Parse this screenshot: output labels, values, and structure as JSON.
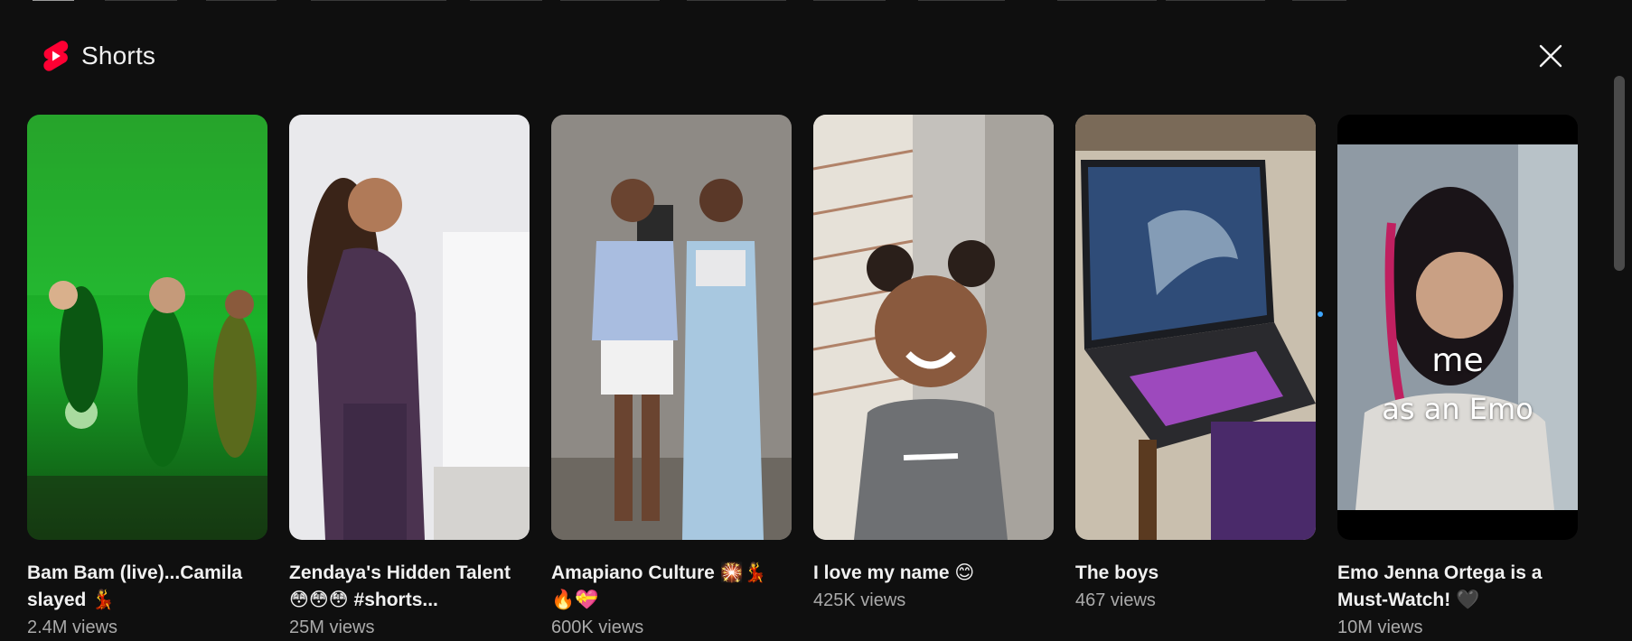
{
  "shelf": {
    "title": "Shorts",
    "logo_icon": "youtube-shorts-logo",
    "close_icon": "close-icon",
    "brand_color": "#ff0033"
  },
  "shorts": [
    {
      "title": "Bam Bam (live)...Camila slayed 💃",
      "views": "2.4M views"
    },
    {
      "title": "Zendaya's Hidden Talent 😳😳😳 #shorts...",
      "views": "25M views"
    },
    {
      "title": "Amapiano Culture 🎇💃 🔥💝",
      "views": "600K views"
    },
    {
      "title": "I love my name 😊",
      "views": "425K views"
    },
    {
      "title": "The boys",
      "views": "467 views"
    },
    {
      "title": "Emo Jenna Ortega is a Must-Watch! 🖤",
      "views": "10M views",
      "overlay_line1": "me",
      "overlay_line2": "as an Emo"
    }
  ]
}
